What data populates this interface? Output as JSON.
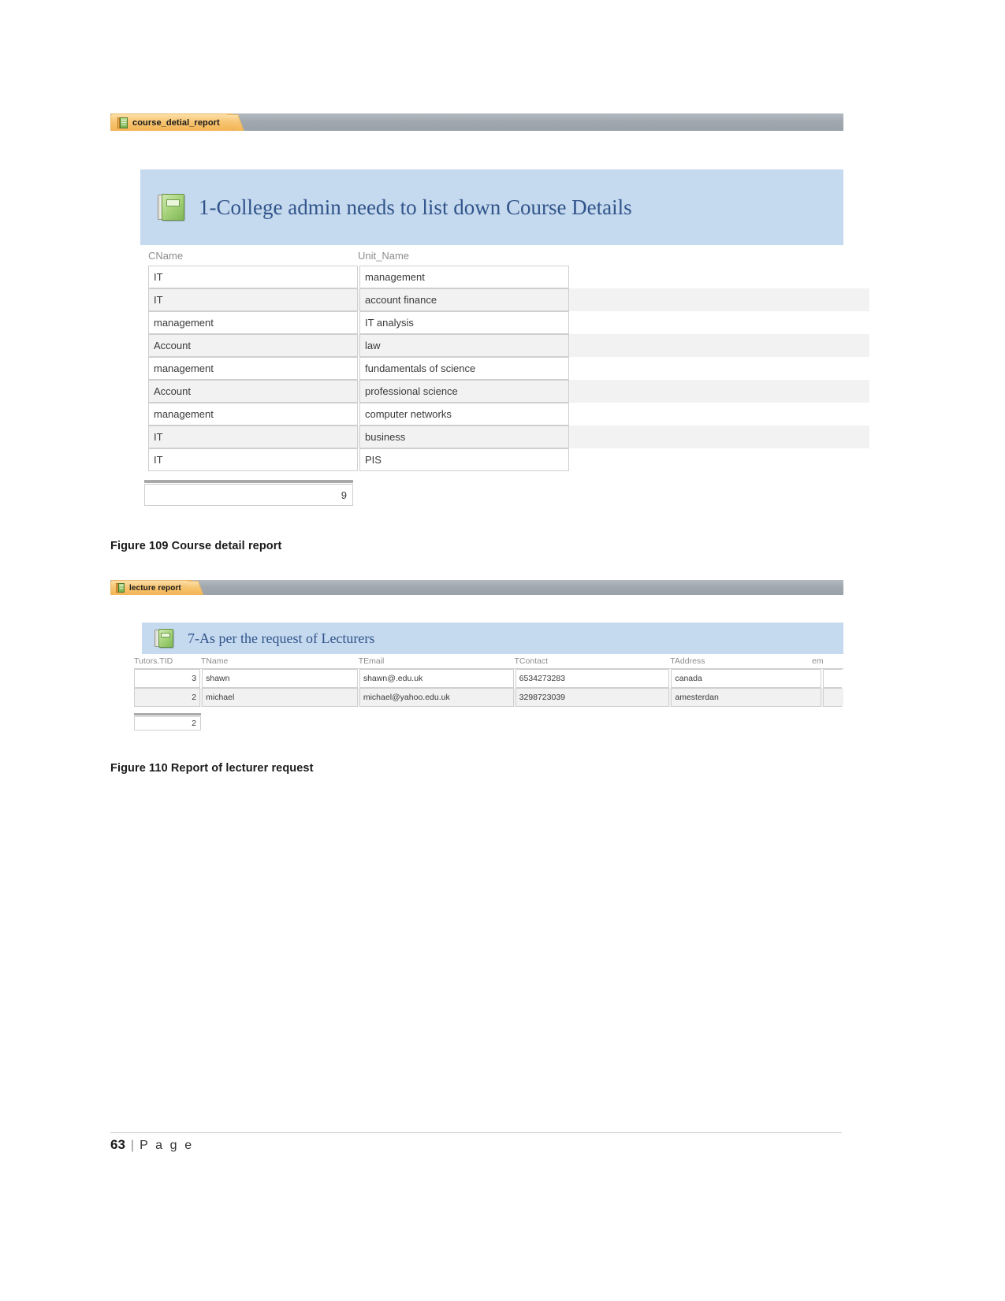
{
  "page": {
    "number": "63",
    "separator": "|",
    "word": "P a g e"
  },
  "figures": [
    {
      "id": "figure-109",
      "tab": {
        "label": "course_detial_report",
        "icon": "report-icon"
      },
      "report": {
        "title": "1-College admin needs to list down Course Details",
        "header_icon": "report-book-icon",
        "columns": [
          "CName",
          "Unit_Name"
        ],
        "rows": [
          {
            "CName": "IT",
            "Unit_Name": "management"
          },
          {
            "CName": "IT",
            "Unit_Name": "account finance"
          },
          {
            "CName": "management",
            "Unit_Name": "IT analysis"
          },
          {
            "CName": "Account",
            "Unit_Name": "law"
          },
          {
            "CName": "management",
            "Unit_Name": "fundamentals of science"
          },
          {
            "CName": "Account",
            "Unit_Name": "professional science"
          },
          {
            "CName": "management",
            "Unit_Name": "computer networks"
          },
          {
            "CName": "IT",
            "Unit_Name": "business"
          },
          {
            "CName": "IT",
            "Unit_Name": "PIS"
          }
        ],
        "count": "9"
      },
      "caption": "Figure 109 Course detail report"
    },
    {
      "id": "figure-110",
      "tab": {
        "label": "lecture report",
        "icon": "report-icon"
      },
      "report": {
        "title": "7-As per the request of Lecturers",
        "header_icon": "report-book-icon",
        "columns": [
          "Tutors.TID",
          "TName",
          "TEmail",
          "TContact",
          "TAddress",
          "em"
        ],
        "rows": [
          {
            "TID": "3",
            "TName": "shawn",
            "TEmail": "shawn@.edu.uk",
            "TContact": "6534273283",
            "TAddress": "canada",
            "extra": ""
          },
          {
            "TID": "2",
            "TName": "michael",
            "TEmail": "michael@yahoo.edu.uk",
            "TContact": "3298723039",
            "TAddress": "amesterdan",
            "extra": ""
          }
        ],
        "count": "2"
      },
      "caption": "Figure 110 Report of lecturer request"
    }
  ],
  "colors": {
    "tab_orange": "#f7c572",
    "tabbar_gray": "#a7adb5",
    "report_header_blue": "#c5d9ef",
    "report_title_blue": "#31558a",
    "row_alt": "#f2f2f2"
  }
}
